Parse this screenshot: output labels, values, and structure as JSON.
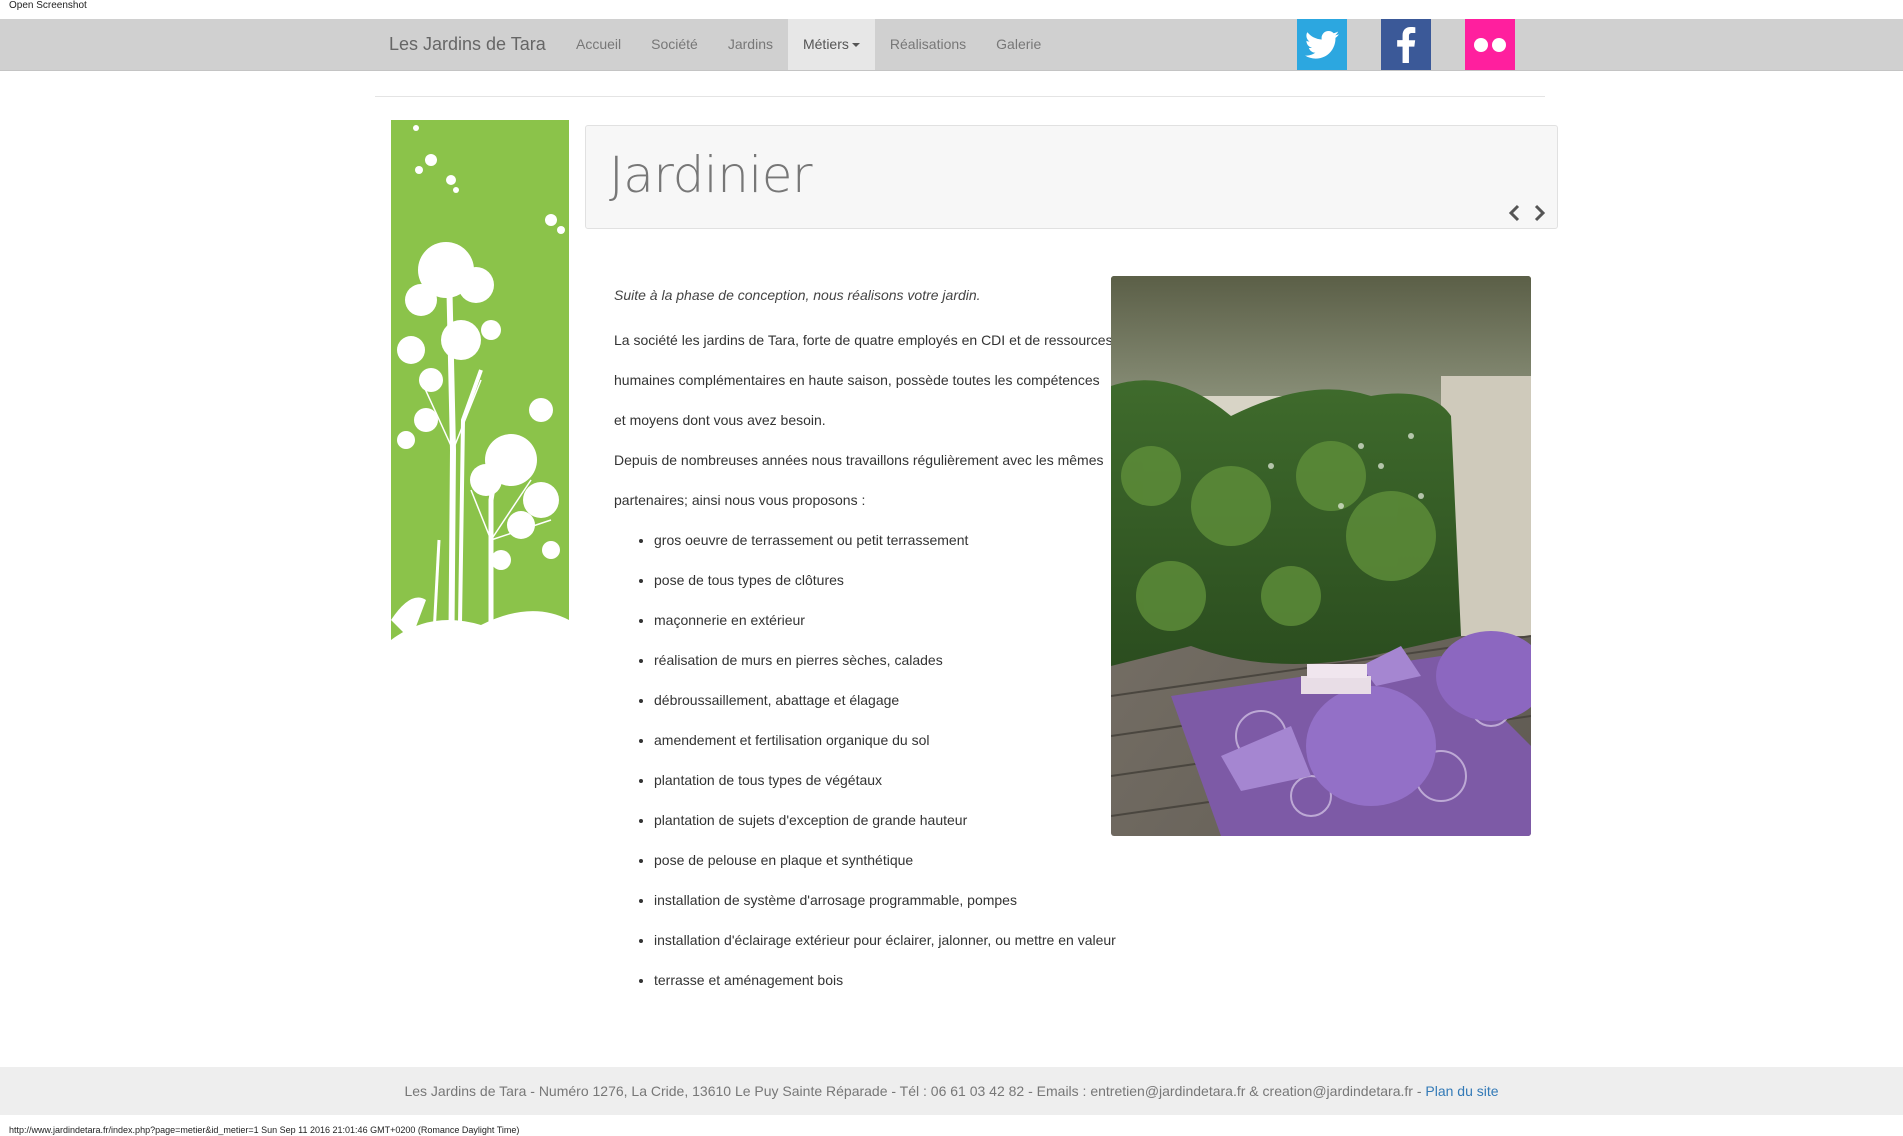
{
  "window": {
    "caption": "Open Screenshot"
  },
  "navbar": {
    "brand": "Les Jardins de Tara",
    "items": [
      {
        "label": "Accueil"
      },
      {
        "label": "Société"
      },
      {
        "label": "Jardins"
      },
      {
        "label": "Métiers",
        "active": true,
        "dropdown": true
      },
      {
        "label": "Réalisations"
      },
      {
        "label": "Galerie"
      }
    ],
    "social": [
      {
        "icon": "twitter-icon",
        "color": "#2ca7e0"
      },
      {
        "icon": "facebook-icon",
        "color": "#3b5998"
      },
      {
        "icon": "flickr-icon",
        "color": "#ff1f9e"
      }
    ]
  },
  "page": {
    "title": "Jardinier",
    "intro": "Suite à la phase de conception, nous réalisons votre jardin.",
    "paragraphs": [
      "La société les jardins de Tara, forte de quatre employés en CDI et de ressources humaines complémentaires en haute saison, possède toutes les compétences et moyens dont vous avez besoin.",
      "Depuis de nombreuses années nous travaillons régulièrement avec les mêmes partenaires; ainsi nous vous proposons :"
    ],
    "services": [
      "gros oeuvre de terrassement ou petit terrassement",
      "pose de tous types de clôtures",
      "maçonnerie en extérieur",
      "réalisation de murs en pierres sèches, calades",
      "débroussaillement, abattage et élagage",
      "amendement et fertilisation organique du sol",
      "plantation de tous types de végétaux",
      "plantation de sujets d'exception de grande hauteur",
      "pose de pelouse en plaque et synthétique",
      "installation de système d'arrosage programmable, pompes",
      "installation d'éclairage extérieur pour éclairer, jalonner, ou mettre en valeur",
      "terrasse et aménagement bois"
    ]
  },
  "footer": {
    "text": "Les Jardins de Tara - Numéro 1276, La Cride, 13610 Le Puy Sainte Réparade - Tél : 06 61 03 42 82 - Emails : entretien@jardindetara.fr & creation@jardindetara.fr - ",
    "sitemap_link": "Plan du site"
  },
  "status_bar": {
    "text": "http://www.jardindetara.fr/index.php?page=metier&id_metier=1 Sun Sep 11 2016 21:01:46 GMT+0200 (Romance Daylight Time)"
  },
  "colors": {
    "navbar_bg": "#d0d0d0",
    "side_art_green": "#8bc34a",
    "link_blue": "#337ab7"
  }
}
